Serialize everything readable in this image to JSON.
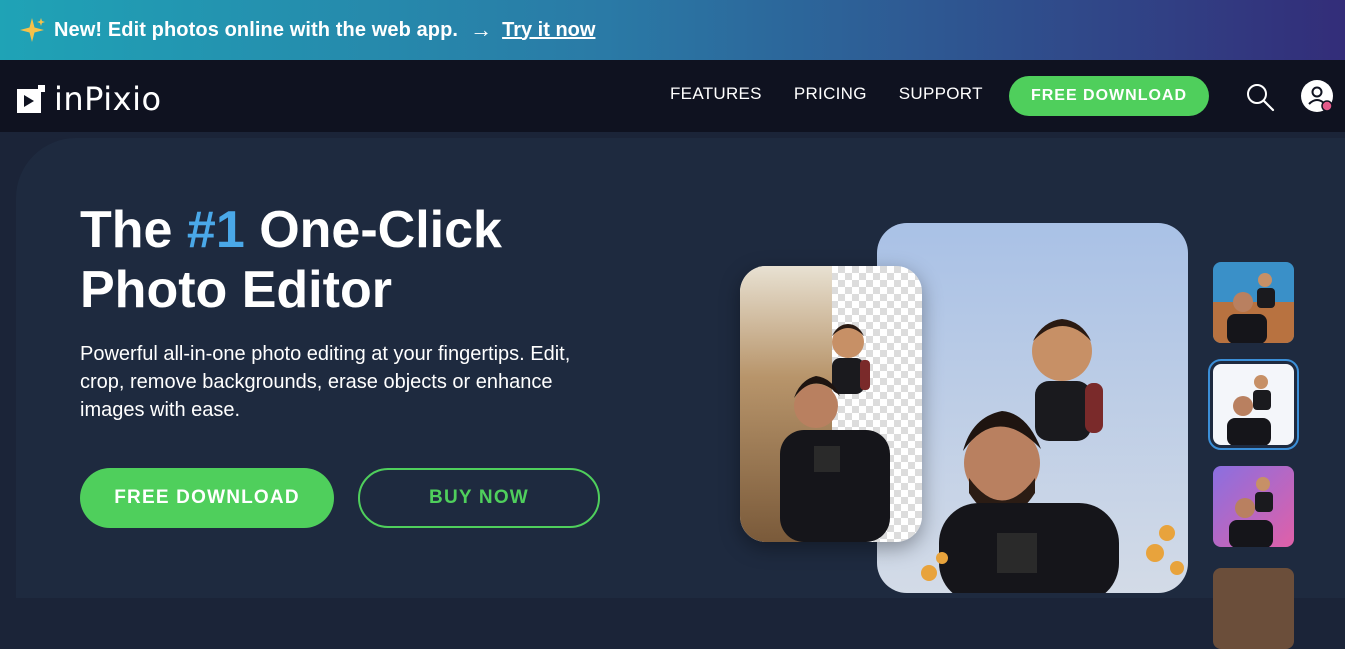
{
  "promo": {
    "message": "New! Edit photos online with the web app.",
    "cta": "Try it now",
    "icon": "sparkle-icon"
  },
  "nav": {
    "brand": "inPixio",
    "links": [
      "FEATURES",
      "PRICING",
      "SUPPORT"
    ],
    "download": "FREE DOWNLOAD",
    "icons": [
      "search-icon",
      "account-icon"
    ]
  },
  "hero": {
    "title_pre": "The ",
    "title_hl": "#1",
    "title_post": " One-Click",
    "title_line2": "Photo Editor",
    "subtitle": "Powerful all-in-one photo editing at your fingertips. Edit, crop, remove backgrounds, erase objects or enhance images with ease.",
    "free_download": "FREE DOWNLOAD",
    "buy_now": "BUY NOW"
  },
  "colors": {
    "accent_green": "#4fcf5c",
    "highlight_blue": "#4aa8e8",
    "hero_bg": "#1e2a3f",
    "nav_bg": "#0f1220"
  }
}
